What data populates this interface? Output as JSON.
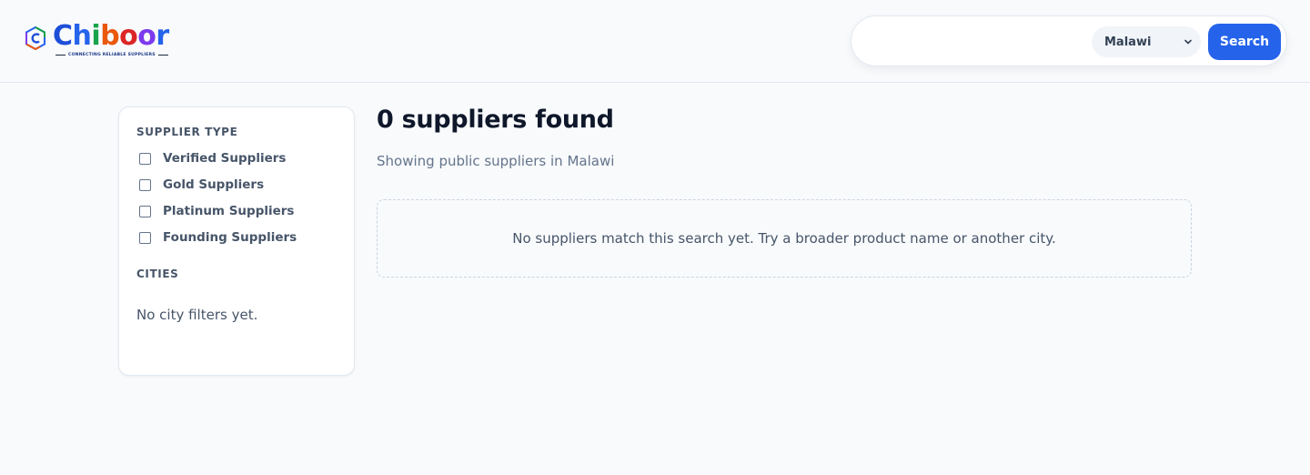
{
  "brand": {
    "name_parts": [
      "C",
      "h",
      "i",
      "b",
      "o",
      "o",
      "r"
    ],
    "tagline": "CONNECTING RELIABLE SUPPLIERS",
    "icon": "hexagon-c-logo-icon"
  },
  "search": {
    "query": "",
    "placeholder": "",
    "country": "Malawi",
    "country_options": [
      "Malawi"
    ],
    "button_label": "Search"
  },
  "sidebar": {
    "supplier_type_title": "SUPPLIER TYPE",
    "supplier_types": [
      {
        "label": "Verified Suppliers",
        "checked": false
      },
      {
        "label": "Gold Suppliers",
        "checked": false
      },
      {
        "label": "Platinum Suppliers",
        "checked": false
      },
      {
        "label": "Founding Suppliers",
        "checked": false
      }
    ],
    "cities_title": "CITIES",
    "no_cities_text": "No city filters yet."
  },
  "results": {
    "title": "0 suppliers found",
    "subtitle": "Showing public suppliers in Malawi",
    "empty_message": "No suppliers match this search yet. Try a broader product name or another city."
  },
  "colors": {
    "accent": "#2563eb",
    "page_bg": "#f8fafc",
    "text_dark": "#0f172a",
    "text_muted": "#64748b"
  }
}
